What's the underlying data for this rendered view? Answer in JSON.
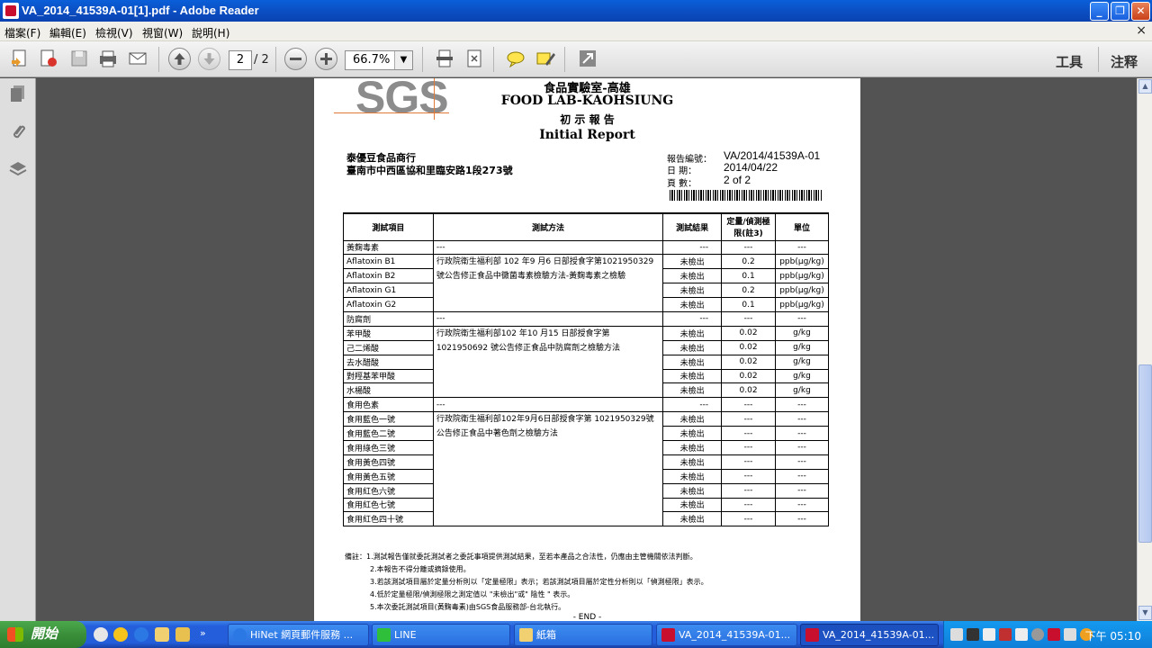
{
  "window": {
    "title": "VA_2014_41539A-01[1].pdf - Adobe Reader",
    "minimize_label": "_",
    "restore_label": "❐",
    "close_label": "✕"
  },
  "menu": {
    "items": [
      "檔案(F)",
      "編輯(E)",
      "檢視(V)",
      "視窗(W)",
      "說明(H)"
    ],
    "close_label": "×"
  },
  "toolbar": {
    "current_page": "2",
    "total_pages": "/ 2",
    "zoom": "66.7%",
    "tools_label": "工具",
    "comment_label": "注释"
  },
  "document": {
    "logo": "SGS",
    "lab_cn": "食品實驗室-高雄",
    "lab_en": "FOOD LAB-KAOHSIUNG",
    "report_cn": "初 示 報 告",
    "report_en": "Initial Report",
    "client_name": "泰優豆食品商行",
    "client_address": "臺南市中西區協和里臨安路1段273號",
    "meta": [
      {
        "label": "報告編號：",
        "value": "VA/2014/41539A-01"
      },
      {
        "label": "日 期：",
        "value": "2014/04/22"
      },
      {
        "label": "頁 數：",
        "value": "2 of 2"
      }
    ],
    "table_headers": [
      "測試項目",
      "測試方法",
      "測試結果",
      "定量/偵測極限(註3)",
      "單位"
    ],
    "groups": [
      {
        "category": "黃麴毒素",
        "dash": "---",
        "method": "行政院衛生福利部 102 年9 月6 日部授食字第1021950329 號公告修正食品中黴菌毒素檢驗方法-黃麴毒素之檢驗",
        "rows": [
          {
            "item": "Aflatoxin B1",
            "result": "未檢出",
            "limit": "0.2",
            "unit": "ppb(μg/kg)"
          },
          {
            "item": "Aflatoxin B2",
            "result": "未檢出",
            "limit": "0.1",
            "unit": "ppb(μg/kg)"
          },
          {
            "item": "Aflatoxin G1",
            "result": "未檢出",
            "limit": "0.2",
            "unit": "ppb(μg/kg)"
          },
          {
            "item": "Aflatoxin G2",
            "result": "未檢出",
            "limit": "0.1",
            "unit": "ppb(μg/kg)"
          }
        ]
      },
      {
        "category": "防腐劑",
        "dash": "---",
        "method": "行政院衛生福利部102 年10 月15 日部授食字第 1021950692 號公告修正食品中防腐劑之檢驗方法",
        "rows": [
          {
            "item": "苯甲酸",
            "result": "未檢出",
            "limit": "0.02",
            "unit": "g/kg"
          },
          {
            "item": "己二烯酸",
            "result": "未檢出",
            "limit": "0.02",
            "unit": "g/kg"
          },
          {
            "item": "去水醋酸",
            "result": "未檢出",
            "limit": "0.02",
            "unit": "g/kg"
          },
          {
            "item": "對羥基苯甲酸",
            "result": "未檢出",
            "limit": "0.02",
            "unit": "g/kg"
          },
          {
            "item": "水楊酸",
            "result": "未檢出",
            "limit": "0.02",
            "unit": "g/kg"
          }
        ]
      },
      {
        "category": "食用色素",
        "dash": "---",
        "method": "行政院衛生福利部102年9月6日部授食字第 1021950329號公告修正食品中著色劑之檢驗方法",
        "rows": [
          {
            "item": "食用藍色一號",
            "result": "未檢出",
            "limit": "---",
            "unit": "---"
          },
          {
            "item": "食用藍色二號",
            "result": "未檢出",
            "limit": "---",
            "unit": "---"
          },
          {
            "item": "食用綠色三號",
            "result": "未檢出",
            "limit": "---",
            "unit": "---"
          },
          {
            "item": "食用黃色四號",
            "result": "未檢出",
            "limit": "---",
            "unit": "---"
          },
          {
            "item": "食用黃色五號",
            "result": "未檢出",
            "limit": "---",
            "unit": "---"
          },
          {
            "item": "食用紅色六號",
            "result": "未檢出",
            "limit": "---",
            "unit": "---"
          },
          {
            "item": "食用紅色七號",
            "result": "未檢出",
            "limit": "---",
            "unit": "---"
          },
          {
            "item": "食用紅色四十號",
            "result": "未檢出",
            "limit": "---",
            "unit": "---"
          }
        ]
      }
    ],
    "notes": [
      "備註：1.測試報告僅就委託測試者之委託事項提供測試結果，至若本產品之合法性，仍應由主管機關依法判斷。",
      "2.本報告不得分離或摘錄使用。",
      "3.若該測試項目屬於定量分析則以「定量極限」表示；若該測試項目屬於定性分析則以「偵測極限」表示。",
      "4.低於定量極限/偵測極限之測定值以 \"未檢出\"或\" 陰性 \" 表示。",
      "5.本次委託測試項目(黃麴毒素)由SGS食品服務部-台北執行。"
    ],
    "end_mark": "- END -"
  },
  "taskbar": {
    "start_label": "開始",
    "tasks": [
      {
        "label": "HiNet 網頁郵件服務 ...",
        "active": false
      },
      {
        "label": "LINE",
        "active": false
      },
      {
        "label": "紙箱",
        "active": false
      },
      {
        "label": "VA_2014_41539A-01...",
        "active": false
      },
      {
        "label": "VA_2014_41539A-01...",
        "active": true
      }
    ],
    "clock": "下午 05:10"
  }
}
